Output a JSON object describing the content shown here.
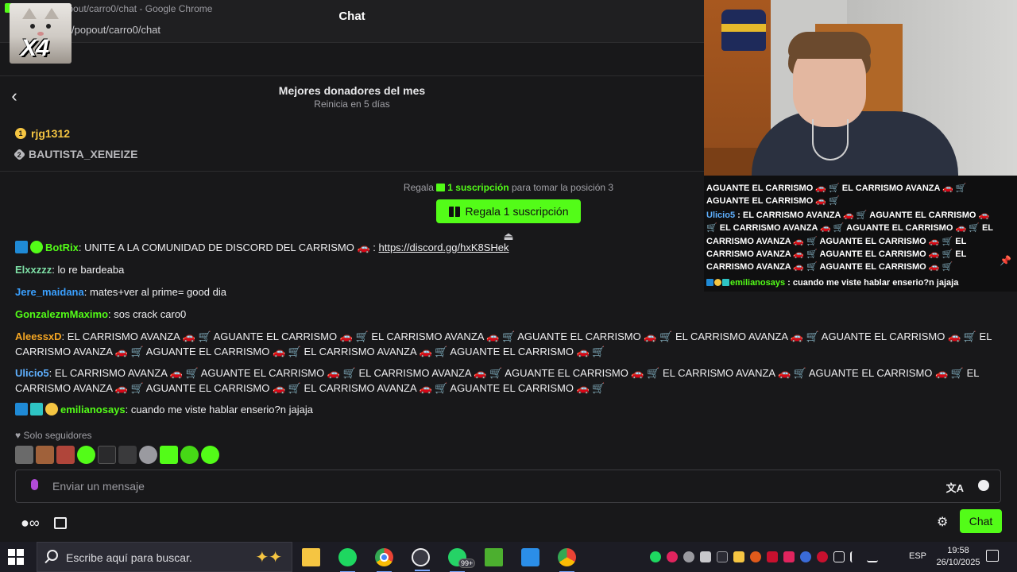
{
  "browser": {
    "window_title": "kick.com/popout/carro0/chat - Google Chrome",
    "url": "/popout/carro0/chat"
  },
  "overlay_cat": {
    "multiplier": "X4"
  },
  "chat": {
    "title": "Chat",
    "donors_title": "Mejores donadores del mes",
    "donors_subtitle": "Reinicia en 5 días",
    "donors": [
      {
        "rank": "1",
        "name": "rjg1312"
      },
      {
        "rank": "2",
        "name": "BAUTISTA_XENEIZE"
      }
    ],
    "gift_prefix": "Regala",
    "gift_highlight": "1 suscripción",
    "gift_suffix": "para tomar la posición 3",
    "gift_button": "Regala 1 suscripción",
    "messages": [
      {
        "user": "BotRix",
        "text": ": UNITE A LA COMUNIDAD DE DISCORD DEL CARRISMO 🚗 : ",
        "link": "https://discord.gg/hxK8SHek"
      },
      {
        "user": "Elxxzzz",
        "text": ": lo re bardeaba"
      },
      {
        "user": "Jere_maidana",
        "text": ": mates+ver al prime= good dia"
      },
      {
        "user": "GonzalezmMaximo",
        "text": ": sos crack caro0"
      },
      {
        "user": "AleessxD",
        "text": ": EL CARRISMO AVANZA 🚗 🛒 AGUANTE EL CARRISMO 🚗 🛒 EL CARRISMO AVANZA 🚗 🛒 AGUANTE EL CARRISMO 🚗 🛒 EL CARRISMO AVANZA 🚗 🛒 AGUANTE EL CARRISMO 🚗 🛒 EL CARRISMO AVANZA 🚗 🛒 AGUANTE EL CARRISMO 🚗 🛒 EL CARRISMO AVANZA 🚗 🛒 AGUANTE EL CARRISMO 🚗 🛒"
      },
      {
        "user": "Ulicio5",
        "text": ": EL CARRISMO AVANZA 🚗 🛒 AGUANTE EL CARRISMO 🚗 🛒 EL CARRISMO AVANZA 🚗 🛒 AGUANTE EL CARRISMO 🚗 🛒 EL CARRISMO AVANZA 🚗 🛒 AGUANTE EL CARRISMO 🚗 🛒 EL CARRISMO AVANZA 🚗 🛒 AGUANTE EL CARRISMO 🚗 🛒 EL CARRISMO AVANZA 🚗 🛒 AGUANTE EL CARRISMO 🚗 🛒"
      },
      {
        "user": "emilianosays",
        "text": ": cuando me viste hablar enserio?n jajaja"
      }
    ],
    "followers_only": "Solo seguidores",
    "input_placeholder": "Enviar un mensaje",
    "chat_button": "Chat"
  },
  "overlay_chat": {
    "line1": "AGUANTE EL CARRISMO 🚗 🛒 EL CARRISMO AVANZA 🚗 🛒 AGUANTE EL CARRISMO 🚗 🛒",
    "user2": "Ulicio5",
    "line2": " : EL CARRISMO AVANZA 🚗 🛒 AGUANTE EL CARRISMO 🚗 🛒 EL CARRISMO AVANZA 🚗 🛒 AGUANTE EL CARRISMO 🚗 🛒 EL CARRISMO AVANZA 🚗 🛒 AGUANTE EL CARRISMO 🚗 🛒 EL CARRISMO AVANZA 🚗 🛒 AGUANTE EL CARRISMO 🚗 🛒 EL CARRISMO AVANZA 🚗 🛒 AGUANTE EL CARRISMO 🚗 🛒",
    "user3": "emilianosays",
    "line3": " : cuando me viste hablar enserio?n jajaja"
  },
  "taskbar": {
    "search_placeholder": "Escribe aquí para buscar.",
    "whatsapp_badge": "99+",
    "language": "ESP",
    "time": "19:58",
    "date": "26/10/2025"
  },
  "colors": {
    "accent": "#53fc18",
    "background": "#18181a"
  }
}
